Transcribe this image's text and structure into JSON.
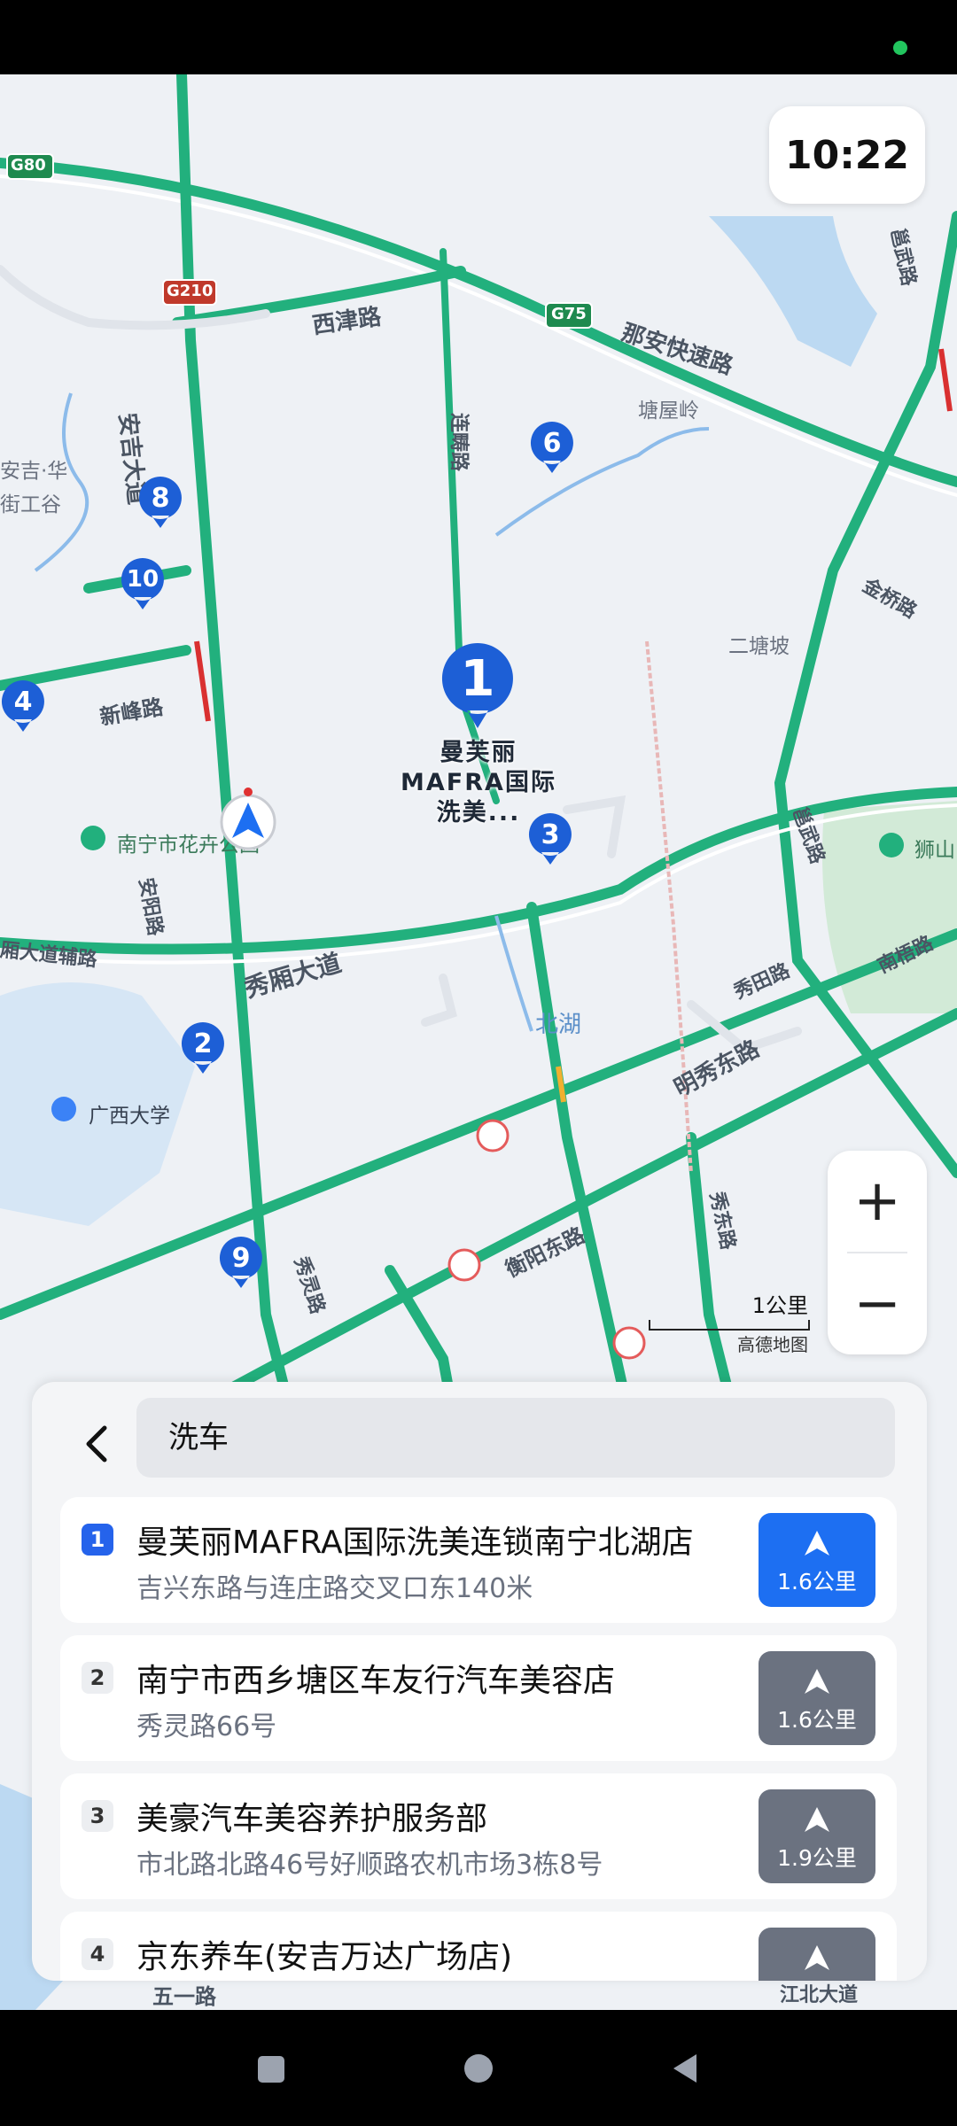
{
  "status": {
    "indicator_color": "#22c55e"
  },
  "clock": {
    "time": "10:22"
  },
  "map": {
    "road_labels": {
      "xijin": "西津路",
      "nanan": "那安快速路",
      "anji": "安吉大道",
      "lianchang": "连畴路",
      "tangwuling": "塘屋岭",
      "anji_hua": "安吉·华",
      "jie_gong_gu": "街工谷",
      "yongwu": "邕武路",
      "jinqiao": "金桥路",
      "ertangpo": "二塘坡",
      "xinfeng": "新峰路",
      "nanning_hua": "南宁市花卉公园",
      "anyang": "安阳路",
      "xiuxiang": "秀厢大道",
      "xiuxiang_fu": "厢大道辅路",
      "yongwu2": "邕武路",
      "shishan": "狮山",
      "xiutian": "秀田路",
      "nanwu": "南梧路",
      "mingxiu": "明秀东路",
      "beihu": "北湖",
      "gxu": "广西大学",
      "hengyang": "衡阳东路",
      "xiuling": "秀灵路",
      "xiudong": "秀东路",
      "wuyi": "五一路",
      "jiangbei": "江北大道",
      "highway_g80": "G80",
      "highway_g210": "G210",
      "highway_g75": "G75"
    },
    "selected_poi_label": "曼芙丽MAFRA国际洗美...",
    "pins": [
      "1",
      "2",
      "3",
      "4",
      "6",
      "8",
      "9",
      "10"
    ],
    "scale": {
      "text": "1公里",
      "brand": "高德地图"
    },
    "zoom": {
      "in": "+",
      "out": "−"
    }
  },
  "search": {
    "query": "洗车",
    "back_icon": "chevron-left-icon"
  },
  "results": [
    {
      "index": "1",
      "name": "曼芙丽MAFRA国际洗美连锁南宁北湖店",
      "address": "吉兴东路与连庄路交叉口东140米",
      "distance": "1.6公里"
    },
    {
      "index": "2",
      "name": "南宁市西乡塘区车友行汽车美容店",
      "address": "秀灵路66号",
      "distance": "1.6公里"
    },
    {
      "index": "3",
      "name": "美豪汽车美容养护服务部",
      "address": "市北路北路46号好顺路农机市场3栋8号",
      "distance": "1.9公里"
    },
    {
      "index": "4",
      "name": "京东养车(安吉万达广场店)",
      "address": "",
      "distance": ""
    }
  ],
  "colors": {
    "road": "#22b07d",
    "pin": "#1d5fd6",
    "active": "#1d6ff2",
    "inactive": "#6b7280"
  }
}
